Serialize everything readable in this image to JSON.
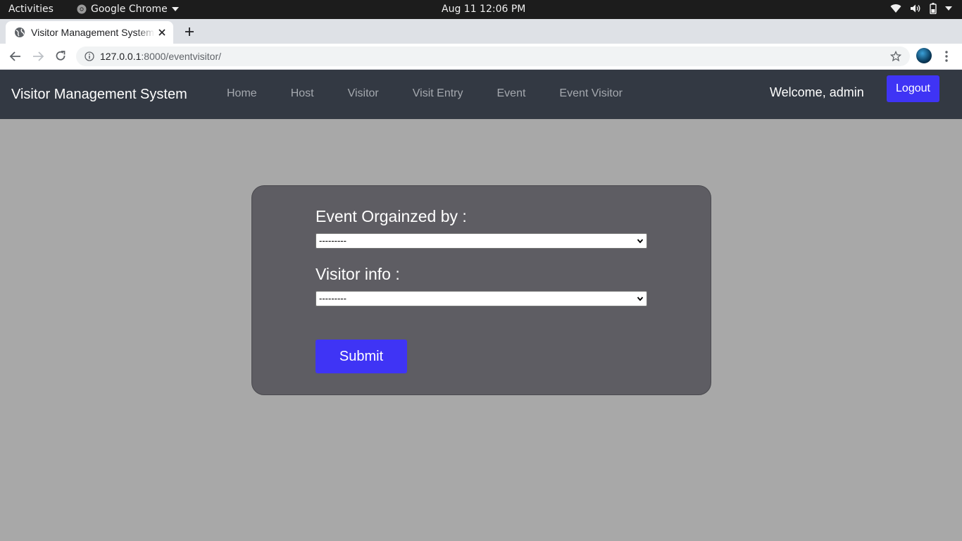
{
  "os": {
    "activities": "Activities",
    "app_name": "Google Chrome",
    "clock": "Aug 11  12:06 PM"
  },
  "browser": {
    "tab_title": "Visitor Management System",
    "url_host": "127.0.0.1",
    "url_path": ":8000/eventvisitor/"
  },
  "navbar": {
    "brand": "Visitor Management System",
    "links": [
      "Home",
      "Host",
      "Visitor",
      "Visit Entry",
      "Event",
      "Event Visitor"
    ],
    "welcome": "Welcome, admin",
    "logout": "Logout"
  },
  "form": {
    "event_label": "Event Orgainzed by :",
    "event_value": "---------",
    "visitor_label": "Visitor info :",
    "visitor_value": "---------",
    "submit": "Submit"
  },
  "colors": {
    "accent": "#3f34f5",
    "navbar_bg": "#333943",
    "page_bg": "#a8a8a8",
    "card_bg": "#5e5d63"
  }
}
